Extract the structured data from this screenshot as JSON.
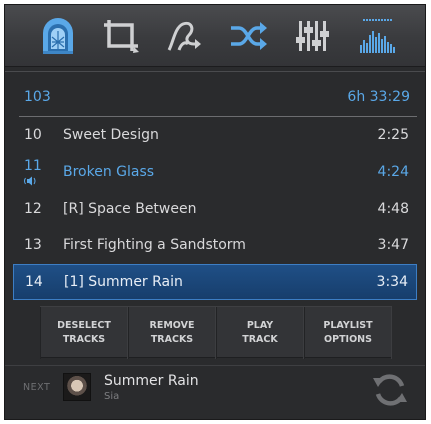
{
  "colors": {
    "accent": "#5aa8e8",
    "background": "#2a2b2d",
    "toolbar": "#3a3b3e",
    "selected_row": "#1f4f86"
  },
  "toolbar": {
    "buttons": [
      {
        "icon": "jukebox-icon"
      },
      {
        "icon": "crop-icon"
      },
      {
        "icon": "swipe-gesture-icon"
      },
      {
        "icon": "shuffle-icon"
      },
      {
        "icon": "equalizer-sliders-icon"
      },
      {
        "icon": "spectrum-visualizer-icon"
      }
    ]
  },
  "summary": {
    "count": "103",
    "total_duration": "6h 33:29"
  },
  "tracks": [
    {
      "number": "10",
      "title": "Sweet Design",
      "duration": "2:25"
    },
    {
      "number": "11",
      "title": "Broken Glass",
      "duration": "4:24",
      "status": "playing"
    },
    {
      "number": "12",
      "title": "[R] Space Between",
      "duration": "4:48"
    },
    {
      "number": "13",
      "title": "First Fighting a Sandstorm",
      "duration": "3:47"
    },
    {
      "number": "14",
      "title": "[1] Summer Rain",
      "duration": "3:34",
      "status": "selected"
    }
  ],
  "actions": {
    "deselect": {
      "line1": "DESELECT",
      "line2": "TRACKS"
    },
    "remove": {
      "line1": "REMOVE",
      "line2": "TRACKS"
    },
    "play": {
      "line1": "PLAY",
      "line2": "TRACK"
    },
    "options": {
      "line1": "PLAYLIST",
      "line2": "OPTIONS"
    }
  },
  "next": {
    "label": "NEXT",
    "title": "Summer Rain",
    "artist": "Sia"
  }
}
